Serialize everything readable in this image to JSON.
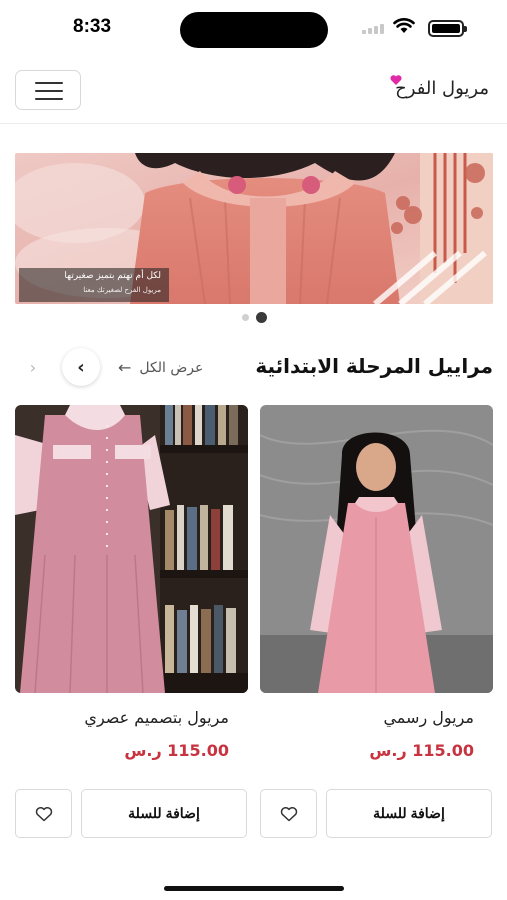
{
  "status_bar": {
    "time": "8:33"
  },
  "header": {
    "brand": "مريول الفرح",
    "heart_color": "#e02aa8"
  },
  "banner": {
    "caption_line1": "لكل أم تهتم بتميز صغيرتها",
    "caption_line2": "مريول الفرح لصغيرتك معنا",
    "slide_count": 2,
    "active_slide": 2
  },
  "section": {
    "title": "مراييل المرحلة الابتدائية",
    "view_all": "عرض الكل"
  },
  "products": [
    {
      "name": "مريول رسمي",
      "price": "115.00 ر.س",
      "add_to_cart": "إضافة للسلة"
    },
    {
      "name": "مريول بتصميم عصري",
      "price": "115.00 ر.س",
      "add_to_cart": "إضافة للسلة"
    }
  ],
  "colors": {
    "price": "#c8333f",
    "accent_pink": "#e9a3b5"
  }
}
